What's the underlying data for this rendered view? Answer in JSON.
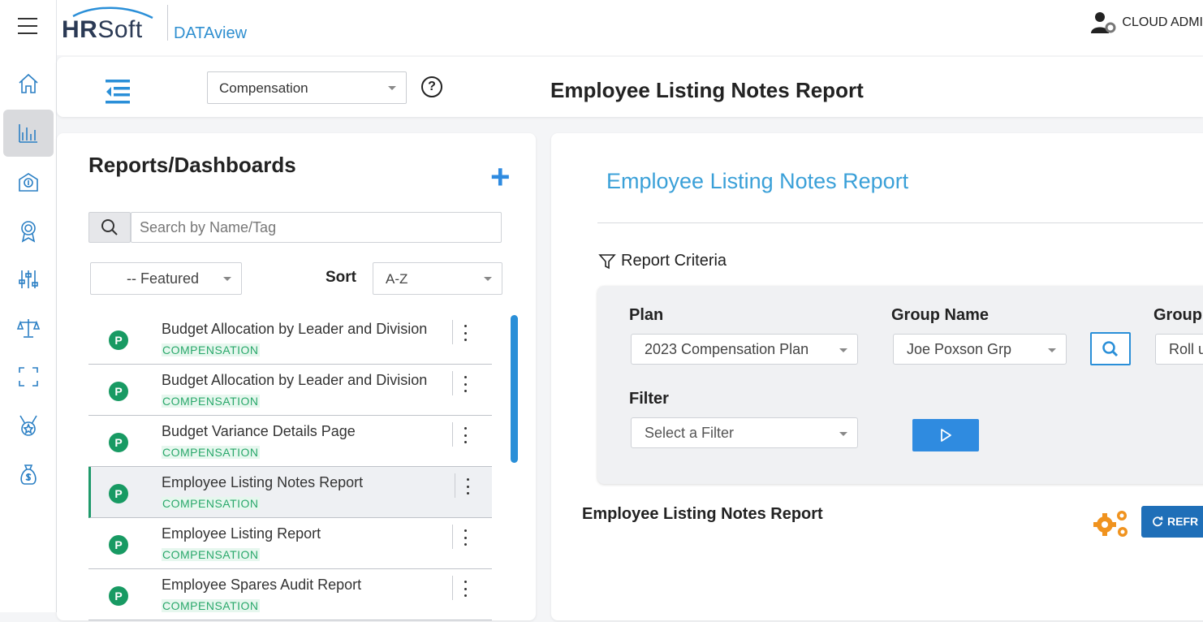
{
  "app": {
    "logo_brand_a": "HR",
    "logo_brand_b": "Soft",
    "product": "DATAview",
    "user_name": "CLOUD ADMI"
  },
  "rail": {
    "items": [
      {
        "icon": "home-icon"
      },
      {
        "icon": "bar-chart-icon",
        "active": true
      },
      {
        "icon": "money-envelope-icon"
      },
      {
        "icon": "award-ribbon-icon"
      },
      {
        "icon": "sliders-icon"
      },
      {
        "icon": "scale-balance-icon"
      },
      {
        "icon": "fullscreen-icon"
      },
      {
        "icon": "medal-star-icon"
      },
      {
        "icon": "money-bag-icon"
      }
    ]
  },
  "subbar": {
    "module": "Compensation",
    "title": "Employee Listing Notes Report"
  },
  "left_panel": {
    "title": "Reports/Dashboards",
    "add_label": "+",
    "search_placeholder": "Search by Name/Tag",
    "featured": "-- Featured",
    "sort_label": "Sort",
    "sort_value": "A-Z",
    "reports": [
      {
        "badge": "P",
        "name": "Budget Allocation by Leader and Division",
        "tag": "COMPENSATION"
      },
      {
        "badge": "P",
        "name": "Budget Allocation by Leader and Division",
        "tag": "COMPENSATION"
      },
      {
        "badge": "P",
        "name": "Budget Variance Details Page",
        "tag": "COMPENSATION"
      },
      {
        "badge": "P",
        "name": "Employee Listing Notes Report",
        "tag": "COMPENSATION",
        "selected": true
      },
      {
        "badge": "P",
        "name": "Employee Listing Report",
        "tag": "COMPENSATION"
      },
      {
        "badge": "P",
        "name": "Employee Spares Audit Report",
        "tag": "COMPENSATION"
      }
    ]
  },
  "right_panel": {
    "title": "Employee Listing Notes Report",
    "criteria_label": "Report Criteria",
    "plan_label": "Plan",
    "plan_value": "2023 Compensation Plan",
    "group_name_label": "Group Name",
    "group_name_value": "Joe Poxson Grp",
    "group_label": "Group",
    "group_value": "Roll u",
    "filter_label": "Filter",
    "filter_placeholder": "Select a Filter",
    "report_subtitle": "Employee Listing Notes Report",
    "refresh_label": "REFR"
  },
  "colors": {
    "accent": "#2f8be0",
    "title_blue": "#3aa0d8",
    "badge_green": "#189a63",
    "tag_green": "#2aa86b",
    "gear_orange": "#f0931f"
  }
}
